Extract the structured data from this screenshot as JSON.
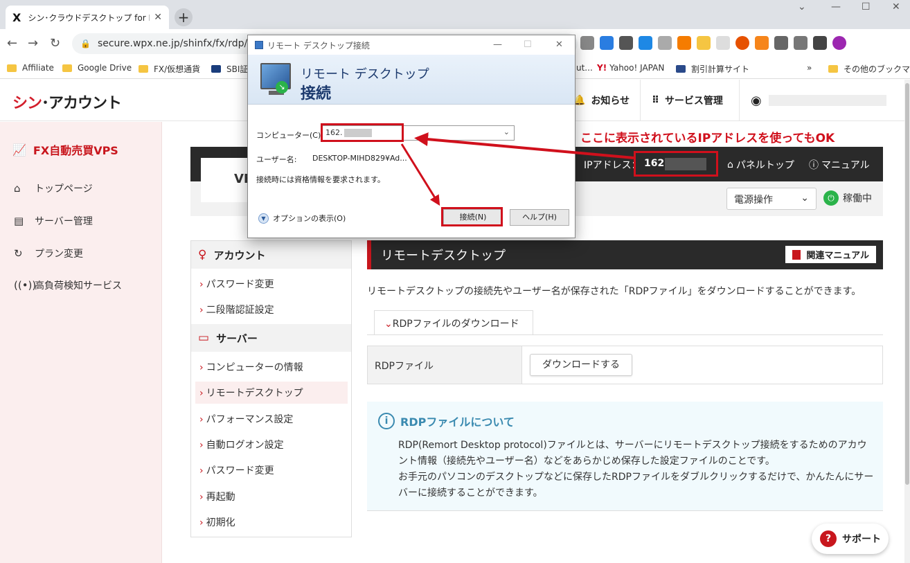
{
  "browser": {
    "tab_title": "シン･クラウドデスクトップ for FX VPS",
    "tab_close": "✕",
    "new_tab": "+",
    "url": "secure.wpx.ne.jp/shinfx/fx/rdp/index",
    "bookmarks": [
      "Affiliate",
      "Google Drive",
      "FX/仮想通貨",
      "SBI証",
      "ut...",
      "Yahoo! JAPAN",
      "割引計算サイト",
      "その他のブックマーク"
    ],
    "bookmarks_more": "»"
  },
  "header": {
    "logo_red": "シン",
    "logo_rest": "･アカウント",
    "notice": "お知らせ",
    "service": "サービス管理"
  },
  "sidebar": {
    "title": "FX自動売買VPS",
    "items": [
      "トップページ",
      "サーバー管理",
      "プラン変更",
      "高負荷検知サービス"
    ]
  },
  "main": {
    "vps_label": "VF",
    "ip_label": "IPアドレス：",
    "ip_value": "162",
    "panel_top": "パネルトップ",
    "manual": "マニュアル",
    "power_select": "電源操作",
    "status": "稼働中"
  },
  "categories": {
    "account_head": "アカウント",
    "account_links": [
      "パスワード変更",
      "二段階認証設定"
    ],
    "server_head": "サーバー",
    "server_links": [
      "コンピューターの情報",
      "リモートデスクトップ",
      "パフォーマンス設定",
      "自動ログオン設定",
      "パスワード変更",
      "再起動",
      "初期化"
    ]
  },
  "content": {
    "section_title": "リモートデスクトップ",
    "manual_button": "関連マニュアル",
    "description": "リモートデスクトップの接続先やユーザー名が保存された「RDPファイル」をダウンロードすることができます。",
    "subtab": "RDPファイルのダウンロード",
    "rdp_label": "RDPファイル",
    "download_button": "ダウンロードする",
    "info_title": "RDPファイルについて",
    "info_line1": "RDP(Remort Desktop protocol)ファイルとは、サーバーにリモートデスクトップ接続をするためのアカウント情報（接続先やユーザー名）などをあらかじめ保存した設定ファイルのことです。",
    "info_line2": "お手元のパソコンのデスクトップなどに保存したRDPファイルをダブルクリックするだけで、かんたんにサーバーに接続することができます。",
    "support": "サポート"
  },
  "dialog": {
    "title": "リモート デスクトップ接続",
    "heading1": "リモート デスクトップ",
    "heading2": "接続",
    "computer_label": "コンピューター(C):",
    "computer_value": "162.",
    "user_label": "ユーザー名:",
    "user_value": "DESKTOP-MIHD829¥Ad...",
    "note": "接続時には資格情報を要求されます。",
    "options": "オプションの表示(O)",
    "connect": "接続(N)",
    "help": "ヘルプ(H)"
  },
  "annotation": {
    "text": "ここに表示されているIPアドレスを使ってもOK"
  },
  "colors": {
    "brand_red": "#c8161d",
    "annotation_red": "#d0101c",
    "status_green": "#2bb34a",
    "info_blue": "#3a8ab0"
  }
}
